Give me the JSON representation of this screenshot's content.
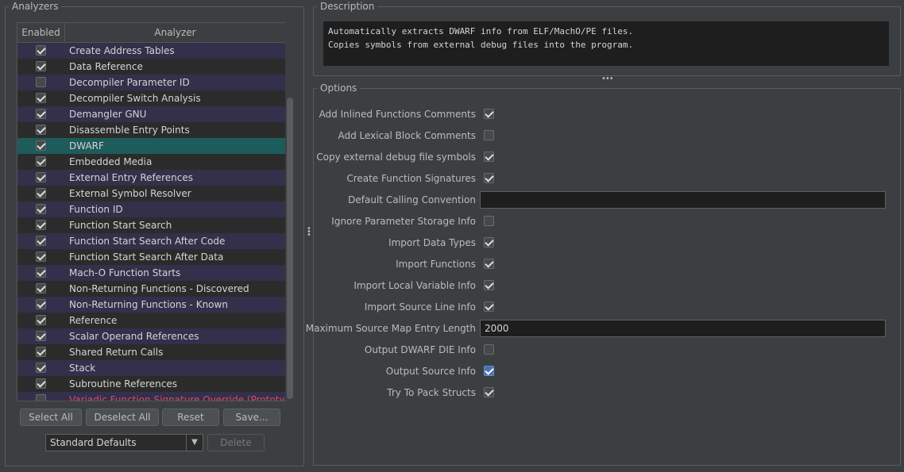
{
  "analyzers": {
    "title": "Analyzers",
    "col_enabled": "Enabled",
    "col_analyzer": "Analyzer",
    "rows": [
      {
        "name": "Create Address Tables",
        "enabled": true
      },
      {
        "name": "Data Reference",
        "enabled": true
      },
      {
        "name": "Decompiler Parameter ID",
        "enabled": false
      },
      {
        "name": "Decompiler Switch Analysis",
        "enabled": true
      },
      {
        "name": "Demangler GNU",
        "enabled": true
      },
      {
        "name": "Disassemble Entry Points",
        "enabled": true
      },
      {
        "name": "DWARF",
        "enabled": true,
        "selected": true
      },
      {
        "name": "Embedded Media",
        "enabled": true
      },
      {
        "name": "External Entry References",
        "enabled": true
      },
      {
        "name": "External Symbol Resolver",
        "enabled": true
      },
      {
        "name": "Function ID",
        "enabled": true
      },
      {
        "name": "Function Start Search",
        "enabled": true
      },
      {
        "name": "Function Start Search After Code",
        "enabled": true
      },
      {
        "name": "Function Start Search After Data",
        "enabled": true
      },
      {
        "name": "Mach-O Function Starts",
        "enabled": true
      },
      {
        "name": "Non-Returning Functions - Discovered",
        "enabled": true
      },
      {
        "name": "Non-Returning Functions - Known",
        "enabled": true
      },
      {
        "name": "Reference",
        "enabled": true
      },
      {
        "name": "Scalar Operand References",
        "enabled": true
      },
      {
        "name": "Shared Return Calls",
        "enabled": true
      },
      {
        "name": "Stack",
        "enabled": true
      },
      {
        "name": "Subroutine References",
        "enabled": true
      },
      {
        "name": "Variadic Function Signature Override (Prototype)",
        "enabled": false,
        "prototype": true
      }
    ],
    "select_all": "Select All",
    "deselect_all": "Deselect All",
    "reset": "Reset",
    "save": "Save...",
    "defaults_value": "Standard Defaults",
    "delete": "Delete"
  },
  "description": {
    "title": "Description",
    "line1": "Automatically extracts DWARF info from ELF/MachO/PE files.",
    "line2": "Copies symbols from external debug files into the program."
  },
  "options": {
    "title": "Options",
    "items": [
      {
        "label": "Add Inlined Functions Comments",
        "type": "checkbox",
        "checked": true
      },
      {
        "label": "Add Lexical Block Comments",
        "type": "checkbox",
        "checked": false
      },
      {
        "label": "Copy external debug file symbols",
        "type": "checkbox",
        "checked": true
      },
      {
        "label": "Create Function Signatures",
        "type": "checkbox",
        "checked": true
      },
      {
        "label": "Default Calling Convention",
        "type": "text",
        "value": ""
      },
      {
        "label": "Ignore Parameter Storage Info",
        "type": "checkbox",
        "checked": false
      },
      {
        "label": "Import Data Types",
        "type": "checkbox",
        "checked": true
      },
      {
        "label": "Import Functions",
        "type": "checkbox",
        "checked": true
      },
      {
        "label": "Import Local Variable Info",
        "type": "checkbox",
        "checked": true
      },
      {
        "label": "Import Source Line Info",
        "type": "checkbox",
        "checked": true
      },
      {
        "label": "Maximum Source Map Entry Length",
        "type": "text",
        "value": "2000"
      },
      {
        "label": "Output DWARF DIE Info",
        "type": "checkbox",
        "checked": false
      },
      {
        "label": "Output Source Info",
        "type": "checkbox",
        "checked": true,
        "focused": true
      },
      {
        "label": "Try To Pack Structs",
        "type": "checkbox",
        "checked": true
      }
    ]
  },
  "colors": {
    "background": "#3c3f41",
    "row_stripe": "#32304a",
    "row_selected": "#1e5b5b",
    "prototype_text": "#d84a6a"
  }
}
